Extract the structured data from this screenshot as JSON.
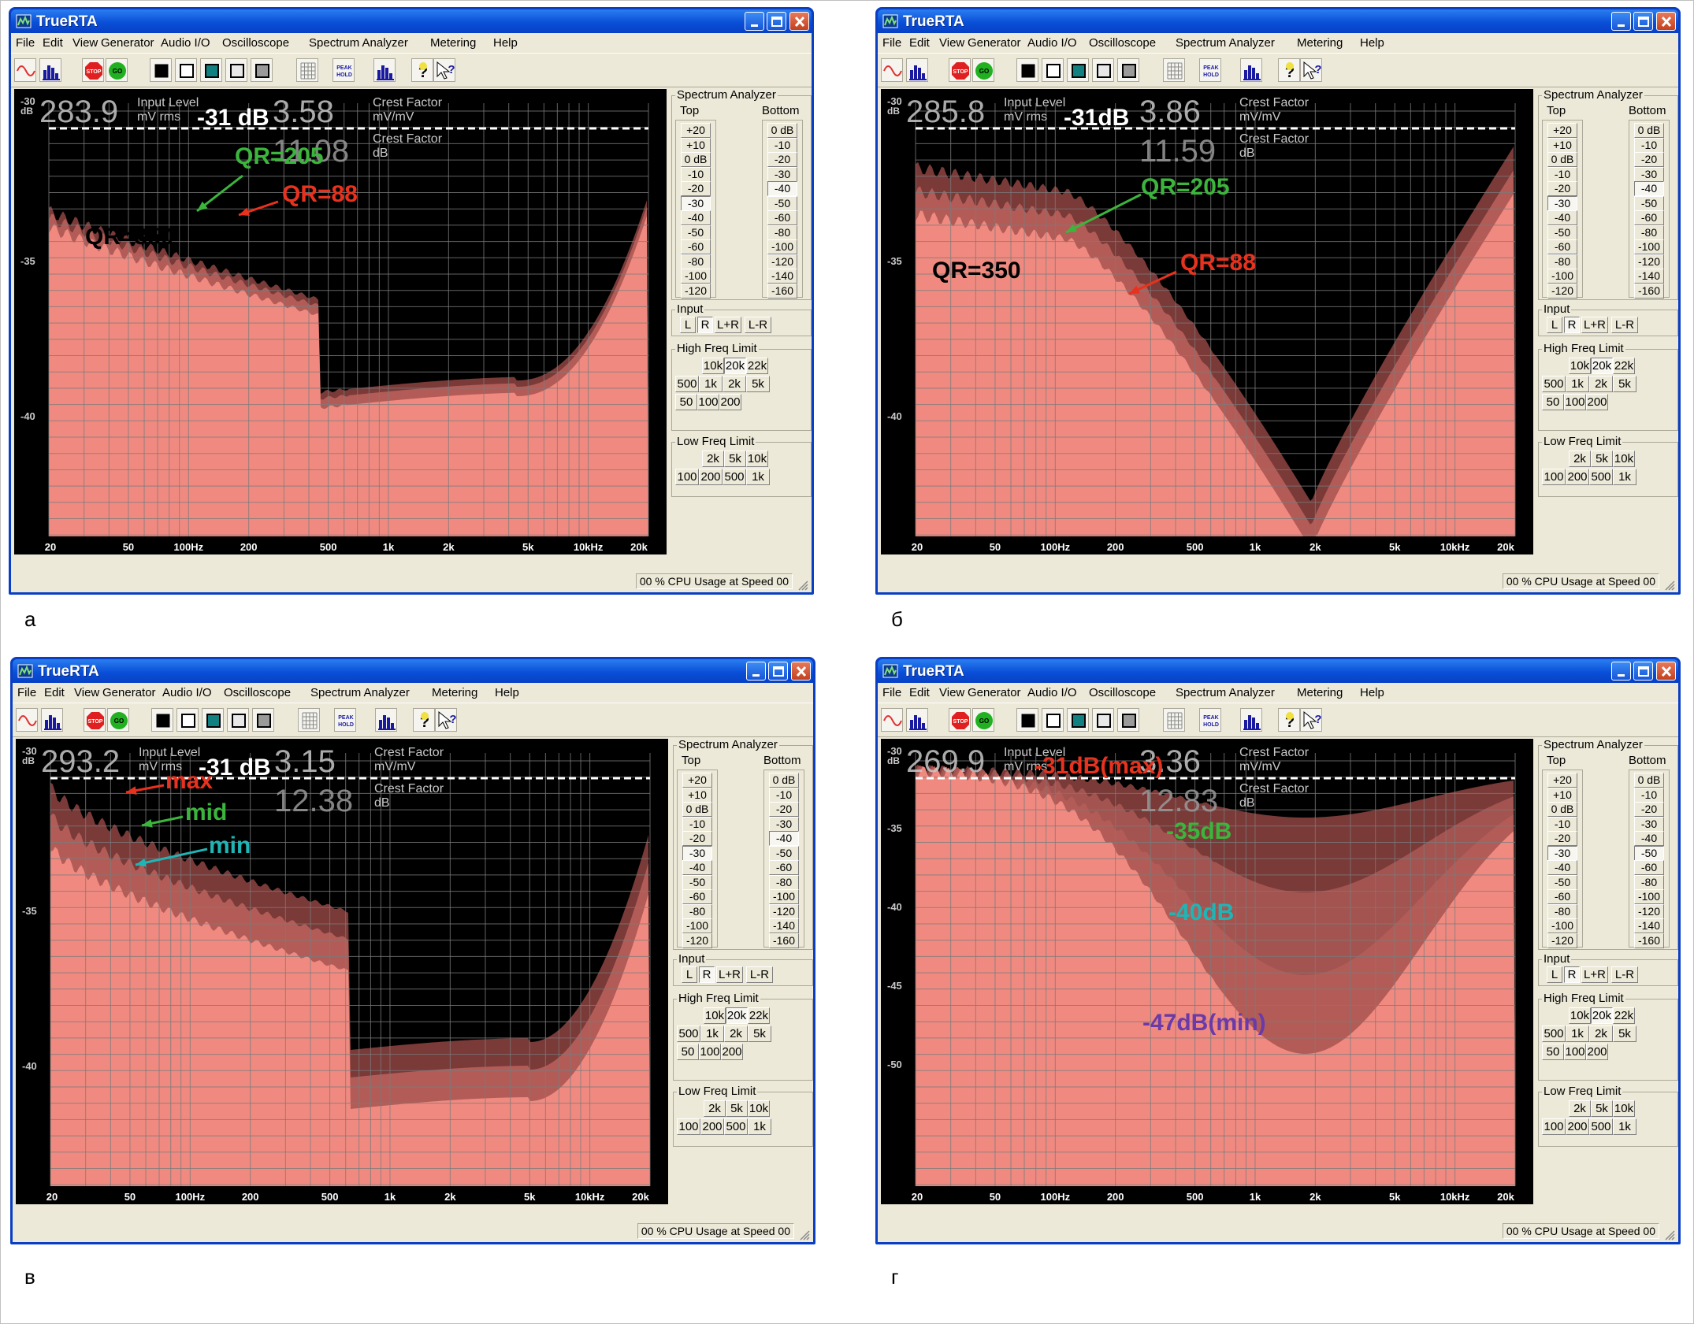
{
  "app_title": "TrueRTA",
  "menu": [
    "File",
    "Edit",
    "View",
    "Generator",
    "Audio I/O",
    "Oscilloscope",
    "Spectrum Analyzer",
    "Metering",
    "Help"
  ],
  "toolbar_icons": [
    "sine-wave-icon",
    "spectrum-icon",
    "stop-icon",
    "go-icon",
    "black-swatch-icon",
    "white-swatch-icon",
    "teal-swatch-icon",
    "light-swatch-icon",
    "gray-swatch-icon",
    "grid-icon",
    "peak-hold-icon",
    "bars-icon",
    "help-icon",
    "whats-this-icon"
  ],
  "toolbar_text": {
    "stop": "STOP",
    "go": "GO",
    "peak_hold_1": "PEAK",
    "peak_hold_2": "HOLD"
  },
  "colors": {
    "spectrum_fill": "#f08a80",
    "grid": "#7a7a7a",
    "trace_dark": "#7a3a38",
    "trace_mid": "#b35c57",
    "graph_bg": "#000000",
    "label_green": "#3cb53c",
    "label_red": "#e8321e",
    "label_cyan": "#20b5b5",
    "label_purple": "#6a3aa8",
    "title_blue": "#0a50dc"
  },
  "side": {
    "group_title": "Spectrum Analyzer",
    "top_label": "Top",
    "bottom_label": "Bottom",
    "top_buttons": [
      "+20",
      "+10",
      "0 dB",
      "-10",
      "-20",
      "-30",
      "-40",
      "-50",
      "-60",
      "-80",
      "-100",
      "-120"
    ],
    "bottom_buttons": [
      "0 dB",
      "-10",
      "-20",
      "-30",
      "-40",
      "-50",
      "-60",
      "-80",
      "-100",
      "-120",
      "-140",
      "-160"
    ],
    "input_title": "Input",
    "input_buttons": [
      "L",
      "R",
      "L+R",
      "L-R"
    ],
    "hf_title": "High Freq Limit",
    "hf_row1": [
      "10k",
      "20k",
      "22k"
    ],
    "hf_row2": [
      "500",
      "1k",
      "2k",
      "5k"
    ],
    "hf_row3": [
      "50",
      "100",
      "200"
    ],
    "lf_title": "Low Freq Limit",
    "lf_row1": [
      "2k",
      "5k",
      "10k"
    ],
    "lf_row2": [
      "100",
      "200",
      "500",
      "1k"
    ]
  },
  "freq_labels": [
    "20",
    "50",
    "100Hz",
    "200",
    "500",
    "1k",
    "2k",
    "5k",
    "10kHz",
    "20k"
  ],
  "overlay_labels": {
    "input_level": "Input Level",
    "mv_rms": "mV rms",
    "crest_factor": "Crest Factor",
    "mv_mv": "mV/mV",
    "db": "dB"
  },
  "status": "00 % CPU Usage at Speed 00",
  "panels": [
    {
      "caption": "а",
      "y_labels": [
        "-30\ndB",
        "-35",
        "-40"
      ],
      "reading_level": "283.9",
      "reading_db": "-31 dB",
      "crest_mv": "3.58",
      "crest_db": "11.08",
      "top_pressed": "-30",
      "bottom_pressed": "-40",
      "annotations": [
        {
          "text": "QR=205",
          "color": "green"
        },
        {
          "text": "QR=88",
          "color": "red"
        },
        {
          "text": "QR=350",
          "color": "black"
        }
      ]
    },
    {
      "caption": "б",
      "y_labels": [
        "-30\ndB",
        "-35",
        "-40"
      ],
      "reading_level": "285.8",
      "reading_db": "-31dB",
      "crest_mv": "3.86",
      "crest_db": "11.59",
      "top_pressed": "-30",
      "bottom_pressed": "-40",
      "annotations": [
        {
          "text": "QR=205",
          "color": "green"
        },
        {
          "text": "QR=88",
          "color": "red"
        },
        {
          "text": "QR=350",
          "color": "black"
        }
      ]
    },
    {
      "caption": "в",
      "y_labels": [
        "-30\ndB",
        "-35",
        "-40"
      ],
      "reading_level": "293.2",
      "reading_db": "-31 dB",
      "crest_mv": "3.15",
      "crest_db": "12.38",
      "top_pressed": "-30",
      "bottom_pressed": "-40",
      "annotations": [
        {
          "text": "max",
          "color": "red"
        },
        {
          "text": "mid",
          "color": "green"
        },
        {
          "text": "min",
          "color": "cyan"
        }
      ]
    },
    {
      "caption": "г",
      "y_labels": [
        "-30\ndB",
        "-35",
        "-40",
        "-45",
        "-50"
      ],
      "reading_level": "269.9",
      "reading_db": "",
      "crest_mv": "3.36",
      "crest_db": "12.83",
      "top_pressed": "-30",
      "bottom_pressed": "-50",
      "annotations": [
        {
          "text": "-31dB(max)",
          "color": "red"
        },
        {
          "text": "-35dB",
          "color": "green"
        },
        {
          "text": "-40dB",
          "color": "cyan"
        },
        {
          "text": "-47dB(min)",
          "color": "purple"
        }
      ]
    }
  ]
}
